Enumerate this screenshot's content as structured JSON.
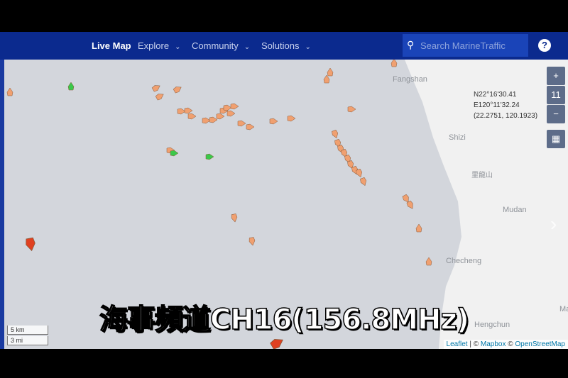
{
  "nav": {
    "items": [
      {
        "label": "Live Map",
        "active": true
      },
      {
        "label": "Explore",
        "dropdown": true
      },
      {
        "label": "Community",
        "dropdown": true
      },
      {
        "label": "Solutions",
        "dropdown": true
      }
    ],
    "search_placeholder": "Search MarineTraffic",
    "help": "?"
  },
  "map": {
    "places": [
      "Fangshan",
      "Shizi",
      "Mudan",
      "Checheng",
      "Hengchun",
      "里龍山",
      "Ma"
    ],
    "zoom_in": "+",
    "zoom_level": "11",
    "zoom_out": "−",
    "coords": {
      "lat": "N22°16'30.41",
      "lon": "E120°11'32.24",
      "decimal": "(22.2751, 120.1923)"
    },
    "scale": {
      "km": "5 km",
      "mi": "3 mi"
    },
    "attribution": {
      "leaflet": "Leaflet",
      "mapbox": "Mapbox",
      "osm": "OpenStreetMap"
    },
    "colors": {
      "sea": "#d3d6dc",
      "land": "#f2f2f2",
      "cargo": "#f0a070",
      "passenger": "#3ac84a",
      "tanker": "#e04020"
    }
  },
  "subtitle": "海事頻道CH16(156.8MHz)"
}
